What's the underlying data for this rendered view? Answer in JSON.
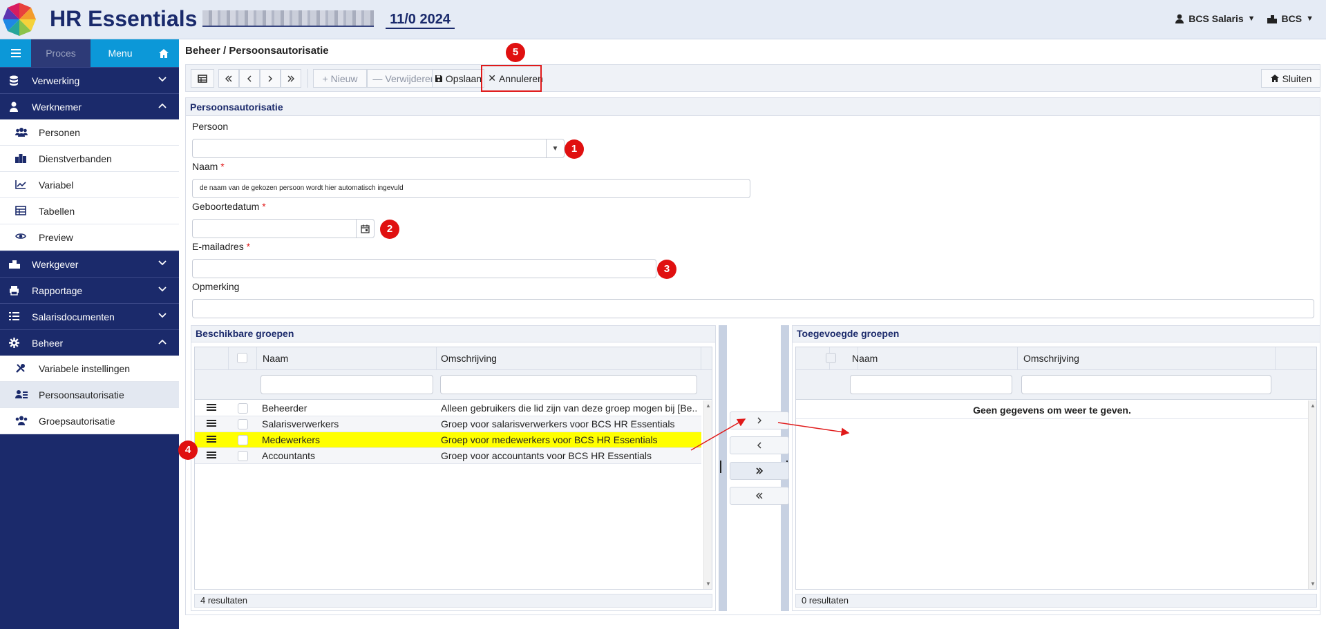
{
  "app": {
    "title": "HR Essentials",
    "period": "11/0 2024",
    "user_menu": "BCS Salaris",
    "company_menu": "BCS"
  },
  "sidebar": {
    "tabs": {
      "proces": "Proces",
      "menu": "Menu"
    },
    "groups": [
      {
        "label": "Verwerking",
        "icon": "database-icon",
        "expanded": false
      },
      {
        "label": "Werknemer",
        "icon": "person-icon",
        "expanded": true,
        "items": [
          {
            "label": "Personen",
            "icon": "users-icon"
          },
          {
            "label": "Dienstverbanden",
            "icon": "buildings-icon"
          },
          {
            "label": "Variabel",
            "icon": "line-chart-icon"
          },
          {
            "label": "Tabellen",
            "icon": "table-icon"
          },
          {
            "label": "Preview",
            "icon": "eye-icon"
          }
        ]
      },
      {
        "label": "Werkgever",
        "icon": "company-icon",
        "expanded": false
      },
      {
        "label": "Rapportage",
        "icon": "print-icon",
        "expanded": false
      },
      {
        "label": "Salarisdocumenten",
        "icon": "list-icon",
        "expanded": false
      },
      {
        "label": "Beheer",
        "icon": "gear-icon",
        "expanded": true,
        "items": [
          {
            "label": "Variabele instellingen",
            "icon": "tools-icon"
          },
          {
            "label": "Persoonsautorisatie",
            "icon": "user-auth-icon",
            "active": true
          },
          {
            "label": "Groepsautorisatie",
            "icon": "group-icon"
          }
        ]
      }
    ]
  },
  "breadcrumb": "Beheer / Persoonsautorisatie",
  "toolbar": {
    "new_label": "Nieuw",
    "delete_label": "Verwijderen",
    "save_label": "Opslaan",
    "cancel_label": "Annuleren",
    "close_label": "Sluiten"
  },
  "form": {
    "section_title": "Persoonsautorisatie",
    "persoon_label": "Persoon",
    "naam_label": "Naam",
    "naam_value": "de naam van de gekozen persoon wordt hier automatisch ingevuld",
    "geboortedatum_label": "Geboortedatum",
    "email_label": "E-mailadres",
    "opmerking_label": "Opmerking",
    "required_mark": "*"
  },
  "available_groups": {
    "title": "Beschikbare groepen",
    "columns": [
      "Naam",
      "Omschrijving"
    ],
    "rows": [
      {
        "naam": "Beheerder",
        "omschrijving": "Alleen gebruikers die lid zijn van deze groep mogen bij [Be..."
      },
      {
        "naam": "Salarisverwerkers",
        "omschrijving": "Groep voor salarisverwerkers voor BCS HR Essentials"
      },
      {
        "naam": "Medewerkers",
        "omschrijving": "Groep voor medewerkers voor BCS HR Essentials",
        "highlighted": true
      },
      {
        "naam": "Accountants",
        "omschrijving": "Groep voor accountants voor BCS HR Essentials"
      }
    ],
    "footer": "4 resultaten"
  },
  "added_groups": {
    "title": "Toegevoegde groepen",
    "columns": [
      "Naam",
      "Omschrijving"
    ],
    "empty_message": "Geen gegevens om weer te geven.",
    "footer": "0 resultaten"
  },
  "markers": [
    "1",
    "2",
    "3",
    "4",
    "5"
  ],
  "colors": {
    "brand": "#1b2a6b",
    "accent": "#0c98d8",
    "highlight": "#ffff00",
    "marker": "#e01010"
  }
}
